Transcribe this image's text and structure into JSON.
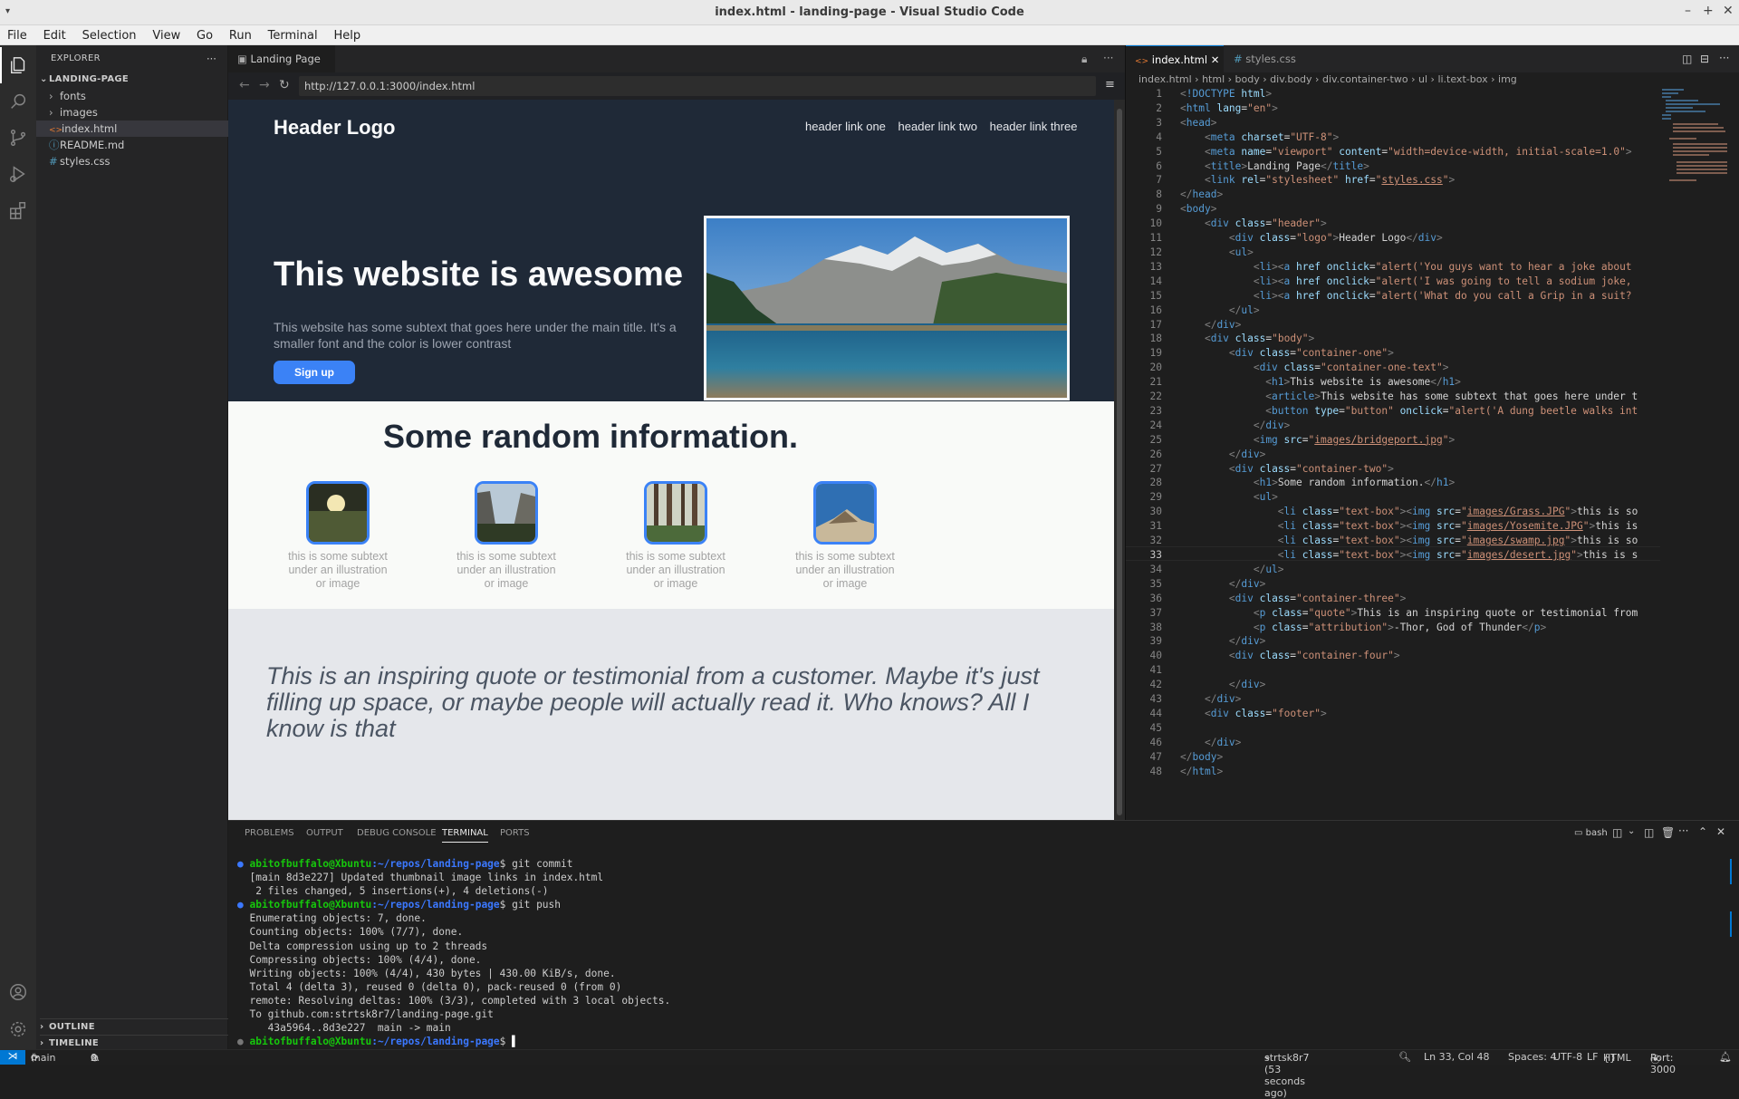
{
  "window": {
    "title": "index.html - landing-page - Visual Studio Code"
  },
  "menu": [
    "File",
    "Edit",
    "Selection",
    "View",
    "Go",
    "Run",
    "Terminal",
    "Help"
  ],
  "sidebar": {
    "header": "EXPLORER",
    "project": "LANDING-PAGE",
    "items": [
      {
        "label": "fonts",
        "kind": "folder"
      },
      {
        "label": "images",
        "kind": "folder"
      },
      {
        "label": "index.html",
        "kind": "html"
      },
      {
        "label": "README.md",
        "kind": "md"
      },
      {
        "label": "styles.css",
        "kind": "css"
      }
    ],
    "outline": "OUTLINE",
    "timeline": "TIMELINE"
  },
  "browser": {
    "tab": "Landing Page",
    "url": "http://127.0.0.1:3000/index.html"
  },
  "site": {
    "logo": "Header Logo",
    "links": [
      "header link one",
      "header link two",
      "header link three"
    ],
    "hero_title": "This website is awesome",
    "hero_text": "This website has some subtext that goes here under the main title. It's a smaller font and the color is lower contrast",
    "signup": "Sign up",
    "info_title": "Some random information.",
    "cards": [
      "this is some subtext under an illustration or image",
      "this is some subtext under an illustration or image",
      "this is some subtext under an illustration or image",
      "this is some subtext under an illustration or image"
    ],
    "quote": "This is an inspiring quote or testimonial from a customer. Maybe it's just filling up space, or maybe people will actually read it. Who knows? All I know is that"
  },
  "editor": {
    "tabs": [
      "index.html",
      "styles.css"
    ],
    "breadcrumb": [
      "index.html",
      "html",
      "body",
      "div.body",
      "div.container-two",
      "ul",
      "li.text-box",
      "img"
    ]
  },
  "panel": {
    "tabs": [
      "PROBLEMS",
      "OUTPUT",
      "DEBUG CONSOLE",
      "TERMINAL",
      "PORTS"
    ],
    "shell": "bash",
    "prompt_user": "abitofbuffalo@Xbuntu",
    "prompt_path": ":~/repos/landing-page",
    "lines": [
      {
        "p": true,
        "cmd": "git commit"
      },
      {
        "t": "[main 8d3e227] Updated thumbnail image links in index.html"
      },
      {
        "t": " 2 files changed, 5 insertions(+), 4 deletions(-)"
      },
      {
        "p": true,
        "cmd": "git push"
      },
      {
        "t": "Enumerating objects: 7, done."
      },
      {
        "t": "Counting objects: 100% (7/7), done."
      },
      {
        "t": "Delta compression using up to 2 threads"
      },
      {
        "t": "Compressing objects: 100% (4/4), done."
      },
      {
        "t": "Writing objects: 100% (4/4), 430 bytes | 430.00 KiB/s, done."
      },
      {
        "t": "Total 4 (delta 3), reused 0 (delta 0), pack-reused 0 (from 0)"
      },
      {
        "t": "remote: Resolving deltas: 100% (3/3), completed with 3 local objects."
      },
      {
        "t": "To github.com:strtsk8r7/landing-page.git"
      },
      {
        "t": "   43a5964..8d3e227  main -> main"
      },
      {
        "p": true,
        "cmd": ""
      }
    ]
  },
  "status": {
    "branch": "main",
    "errors": "0",
    "warnings": "0",
    "blame": "strtsk8r7 (53 seconds ago)",
    "position": "Ln 33, Col 48",
    "spaces": "Spaces: 4",
    "encoding": "UTF-8",
    "eol": "LF",
    "language": "HTML",
    "port": "Port: 3000"
  }
}
